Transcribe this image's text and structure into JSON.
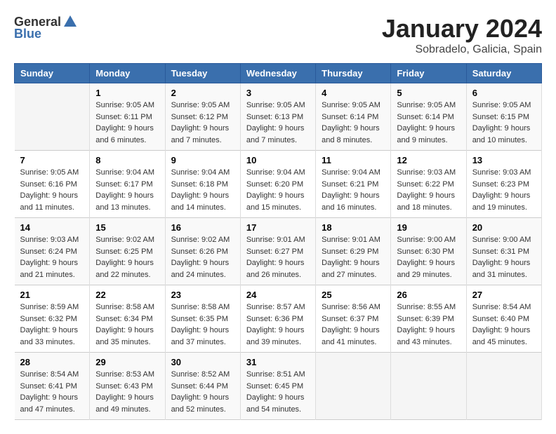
{
  "header": {
    "logo_general": "General",
    "logo_blue": "Blue",
    "title": "January 2024",
    "subtitle": "Sobradelo, Galicia, Spain"
  },
  "days_of_week": [
    "Sunday",
    "Monday",
    "Tuesday",
    "Wednesday",
    "Thursday",
    "Friday",
    "Saturday"
  ],
  "weeks": [
    [
      {
        "day": "",
        "sunrise": "",
        "sunset": "",
        "daylight": ""
      },
      {
        "day": "1",
        "sunrise": "Sunrise: 9:05 AM",
        "sunset": "Sunset: 6:11 PM",
        "daylight": "Daylight: 9 hours and 6 minutes."
      },
      {
        "day": "2",
        "sunrise": "Sunrise: 9:05 AM",
        "sunset": "Sunset: 6:12 PM",
        "daylight": "Daylight: 9 hours and 7 minutes."
      },
      {
        "day": "3",
        "sunrise": "Sunrise: 9:05 AM",
        "sunset": "Sunset: 6:13 PM",
        "daylight": "Daylight: 9 hours and 7 minutes."
      },
      {
        "day": "4",
        "sunrise": "Sunrise: 9:05 AM",
        "sunset": "Sunset: 6:14 PM",
        "daylight": "Daylight: 9 hours and 8 minutes."
      },
      {
        "day": "5",
        "sunrise": "Sunrise: 9:05 AM",
        "sunset": "Sunset: 6:14 PM",
        "daylight": "Daylight: 9 hours and 9 minutes."
      },
      {
        "day": "6",
        "sunrise": "Sunrise: 9:05 AM",
        "sunset": "Sunset: 6:15 PM",
        "daylight": "Daylight: 9 hours and 10 minutes."
      }
    ],
    [
      {
        "day": "7",
        "sunrise": "Sunrise: 9:05 AM",
        "sunset": "Sunset: 6:16 PM",
        "daylight": "Daylight: 9 hours and 11 minutes."
      },
      {
        "day": "8",
        "sunrise": "Sunrise: 9:04 AM",
        "sunset": "Sunset: 6:17 PM",
        "daylight": "Daylight: 9 hours and 13 minutes."
      },
      {
        "day": "9",
        "sunrise": "Sunrise: 9:04 AM",
        "sunset": "Sunset: 6:18 PM",
        "daylight": "Daylight: 9 hours and 14 minutes."
      },
      {
        "day": "10",
        "sunrise": "Sunrise: 9:04 AM",
        "sunset": "Sunset: 6:20 PM",
        "daylight": "Daylight: 9 hours and 15 minutes."
      },
      {
        "day": "11",
        "sunrise": "Sunrise: 9:04 AM",
        "sunset": "Sunset: 6:21 PM",
        "daylight": "Daylight: 9 hours and 16 minutes."
      },
      {
        "day": "12",
        "sunrise": "Sunrise: 9:03 AM",
        "sunset": "Sunset: 6:22 PM",
        "daylight": "Daylight: 9 hours and 18 minutes."
      },
      {
        "day": "13",
        "sunrise": "Sunrise: 9:03 AM",
        "sunset": "Sunset: 6:23 PM",
        "daylight": "Daylight: 9 hours and 19 minutes."
      }
    ],
    [
      {
        "day": "14",
        "sunrise": "Sunrise: 9:03 AM",
        "sunset": "Sunset: 6:24 PM",
        "daylight": "Daylight: 9 hours and 21 minutes."
      },
      {
        "day": "15",
        "sunrise": "Sunrise: 9:02 AM",
        "sunset": "Sunset: 6:25 PM",
        "daylight": "Daylight: 9 hours and 22 minutes."
      },
      {
        "day": "16",
        "sunrise": "Sunrise: 9:02 AM",
        "sunset": "Sunset: 6:26 PM",
        "daylight": "Daylight: 9 hours and 24 minutes."
      },
      {
        "day": "17",
        "sunrise": "Sunrise: 9:01 AM",
        "sunset": "Sunset: 6:27 PM",
        "daylight": "Daylight: 9 hours and 26 minutes."
      },
      {
        "day": "18",
        "sunrise": "Sunrise: 9:01 AM",
        "sunset": "Sunset: 6:29 PM",
        "daylight": "Daylight: 9 hours and 27 minutes."
      },
      {
        "day": "19",
        "sunrise": "Sunrise: 9:00 AM",
        "sunset": "Sunset: 6:30 PM",
        "daylight": "Daylight: 9 hours and 29 minutes."
      },
      {
        "day": "20",
        "sunrise": "Sunrise: 9:00 AM",
        "sunset": "Sunset: 6:31 PM",
        "daylight": "Daylight: 9 hours and 31 minutes."
      }
    ],
    [
      {
        "day": "21",
        "sunrise": "Sunrise: 8:59 AM",
        "sunset": "Sunset: 6:32 PM",
        "daylight": "Daylight: 9 hours and 33 minutes."
      },
      {
        "day": "22",
        "sunrise": "Sunrise: 8:58 AM",
        "sunset": "Sunset: 6:34 PM",
        "daylight": "Daylight: 9 hours and 35 minutes."
      },
      {
        "day": "23",
        "sunrise": "Sunrise: 8:58 AM",
        "sunset": "Sunset: 6:35 PM",
        "daylight": "Daylight: 9 hours and 37 minutes."
      },
      {
        "day": "24",
        "sunrise": "Sunrise: 8:57 AM",
        "sunset": "Sunset: 6:36 PM",
        "daylight": "Daylight: 9 hours and 39 minutes."
      },
      {
        "day": "25",
        "sunrise": "Sunrise: 8:56 AM",
        "sunset": "Sunset: 6:37 PM",
        "daylight": "Daylight: 9 hours and 41 minutes."
      },
      {
        "day": "26",
        "sunrise": "Sunrise: 8:55 AM",
        "sunset": "Sunset: 6:39 PM",
        "daylight": "Daylight: 9 hours and 43 minutes."
      },
      {
        "day": "27",
        "sunrise": "Sunrise: 8:54 AM",
        "sunset": "Sunset: 6:40 PM",
        "daylight": "Daylight: 9 hours and 45 minutes."
      }
    ],
    [
      {
        "day": "28",
        "sunrise": "Sunrise: 8:54 AM",
        "sunset": "Sunset: 6:41 PM",
        "daylight": "Daylight: 9 hours and 47 minutes."
      },
      {
        "day": "29",
        "sunrise": "Sunrise: 8:53 AM",
        "sunset": "Sunset: 6:43 PM",
        "daylight": "Daylight: 9 hours and 49 minutes."
      },
      {
        "day": "30",
        "sunrise": "Sunrise: 8:52 AM",
        "sunset": "Sunset: 6:44 PM",
        "daylight": "Daylight: 9 hours and 52 minutes."
      },
      {
        "day": "31",
        "sunrise": "Sunrise: 8:51 AM",
        "sunset": "Sunset: 6:45 PM",
        "daylight": "Daylight: 9 hours and 54 minutes."
      },
      {
        "day": "",
        "sunrise": "",
        "sunset": "",
        "daylight": ""
      },
      {
        "day": "",
        "sunrise": "",
        "sunset": "",
        "daylight": ""
      },
      {
        "day": "",
        "sunrise": "",
        "sunset": "",
        "daylight": ""
      }
    ]
  ]
}
